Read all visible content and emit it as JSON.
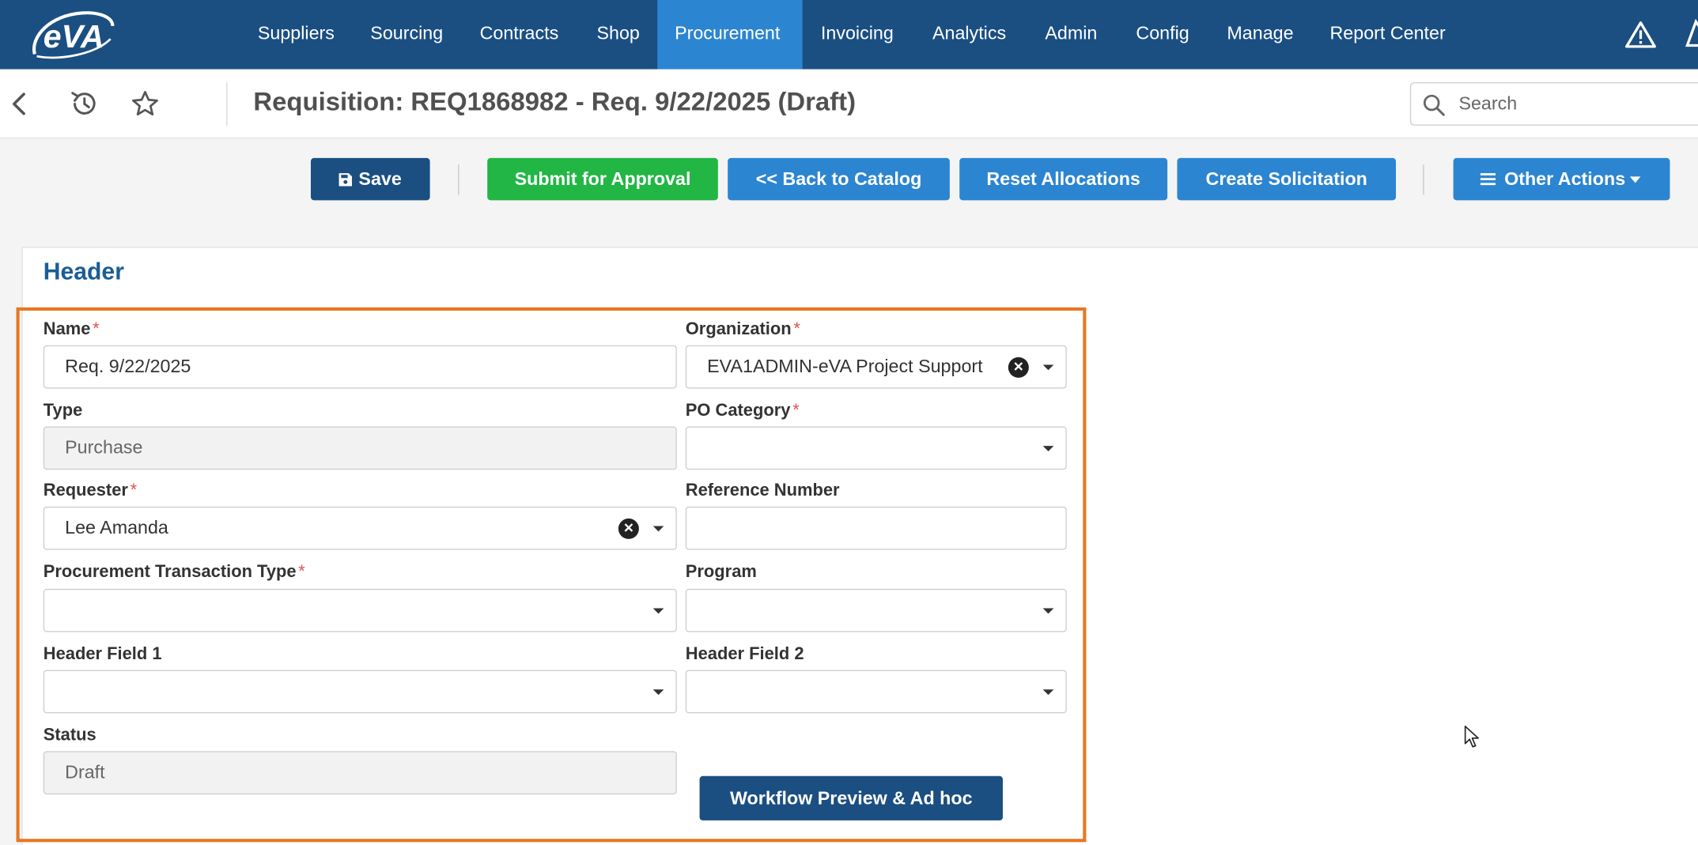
{
  "nav": {
    "logo_text": "eVA",
    "items": [
      "Suppliers",
      "Sourcing",
      "Contracts",
      "Shop",
      "Procurement",
      "Invoicing",
      "Analytics",
      "Admin",
      "Config",
      "Manage",
      "Report Center"
    ],
    "active": "Procurement",
    "icons": [
      "alert-triangle-icon",
      "user-icon"
    ]
  },
  "titlebar": {
    "title": "Requisition: REQ1868982 - Req. 9/22/2025 (Draft)",
    "icons": [
      "back-chevron-icon",
      "history-icon",
      "star-icon"
    ],
    "search_placeholder": "Search"
  },
  "actions": {
    "save": "Save",
    "submit": "Submit for Approval",
    "back_catalog": "<< Back to Catalog",
    "reset": "Reset Allocations",
    "create_solicitation": "Create Solicitation",
    "other_actions": "Other Actions"
  },
  "header": {
    "title": "Header",
    "fields": {
      "name": {
        "label": "Name",
        "value": "Req. 9/22/2025",
        "required": true
      },
      "organization": {
        "label": "Organization",
        "value": "EVA1ADMIN-eVA Project Support",
        "required": true
      },
      "type": {
        "label": "Type",
        "value": "Purchase",
        "required": false
      },
      "po_category": {
        "label": "PO Category",
        "value": "",
        "required": true
      },
      "requester": {
        "label": "Requester",
        "value": "Lee Amanda",
        "required": true
      },
      "reference_number": {
        "label": "Reference Number",
        "value": "",
        "required": false
      },
      "procurement_transaction_type": {
        "label": "Procurement Transaction Type",
        "value": "",
        "required": true
      },
      "program": {
        "label": "Program",
        "value": "",
        "required": false
      },
      "header_field_1": {
        "label": "Header Field 1",
        "value": "",
        "required": false
      },
      "header_field_2": {
        "label": "Header Field 2",
        "value": "",
        "required": false
      },
      "status": {
        "label": "Status",
        "value": "Draft",
        "required": false
      }
    },
    "workflow_button": "Workflow Preview & Ad hoc"
  },
  "colors": {
    "nav_bg": "#1b4f82",
    "nav_active": "#2c85d1",
    "primary_button": "#2c85d1",
    "save_button": "#1b4f82",
    "submit_button": "#22b645",
    "highlight_border": "#e87722",
    "section_title": "#1b5d95",
    "required_asterisk": "#d9534f"
  }
}
